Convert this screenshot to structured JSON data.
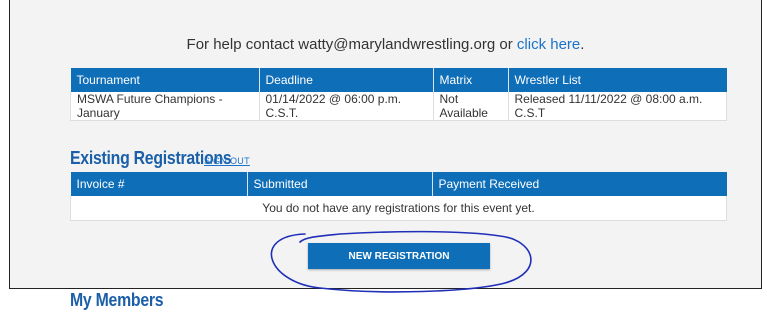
{
  "help": {
    "prefix": "For help contact watty@marylandwrestling.org or ",
    "link": "click here",
    "suffix": "."
  },
  "tournament_table": {
    "headers": [
      "Tournament",
      "Deadline",
      "Matrix",
      "Wrestler List"
    ],
    "row": [
      "MSWA Future Champions - January",
      "01/14/2022 @ 06:00 p.m. C.S.T.",
      "Not Available",
      "Released 11/11/2022 @ 08:00 a.m. C.S.T"
    ]
  },
  "existing": {
    "title": "Existing Registrations",
    "sign_out": "SIGN OUT",
    "headers": [
      "Invoice #",
      "Submitted",
      "Payment Received"
    ],
    "empty_message": "You do not have any registrations for this event yet."
  },
  "new_registration_label": "NEW REGISTRATION",
  "my_members_title": "My Members",
  "colors": {
    "header_blue": "#0f6eb8",
    "link_blue": "#1a73c8",
    "annotation_circle": "#1f2fb8"
  }
}
